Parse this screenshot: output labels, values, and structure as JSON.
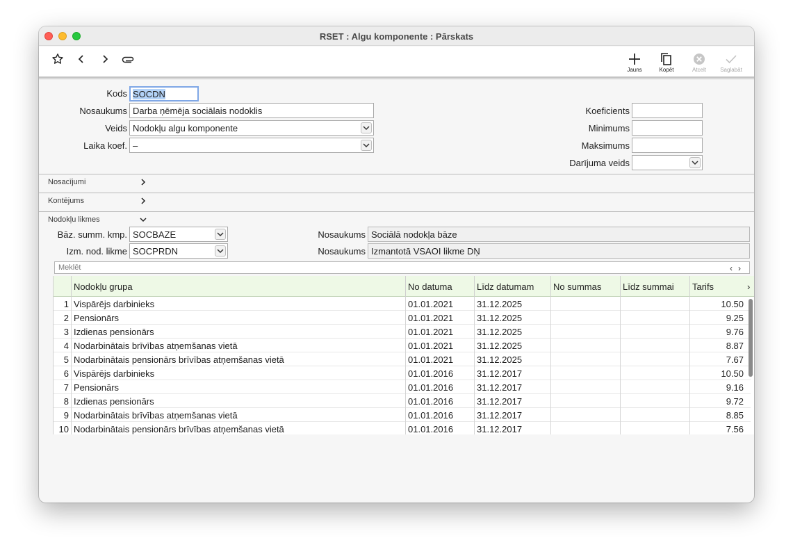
{
  "window": {
    "title": "RSET : Algu komponente : Pārskats"
  },
  "toolbar": {
    "new_label": "Jauns",
    "copy_label": "Kopēt",
    "cancel_label": "Atcelt",
    "save_label": "Saglabāt"
  },
  "form": {
    "kods_label": "Kods",
    "kods_value": "SOCDN",
    "nosaukums_label": "Nosaukums",
    "nosaukums_value": "Darba ņēmēja sociālais nodoklis",
    "veids_label": "Veids",
    "veids_value": "Nodokļu algu komponente",
    "laika_koef_label": "Laika koef.",
    "laika_koef_value": "–",
    "koeficients_label": "Koeficients",
    "koeficients_value": "",
    "minimums_label": "Minimums",
    "minimums_value": "",
    "maksimums_label": "Maksimums",
    "maksimums_value": "",
    "darijuma_veids_label": "Darījuma veids",
    "darijuma_veids_value": ""
  },
  "sections": {
    "nosacijumi": "Nosacījumi",
    "kontejums": "Kontējums",
    "nodoklu_likmes": "Nodokļu likmes"
  },
  "rates": {
    "baz_label": "Bāz. summ. kmp.",
    "baz_value": "SOCBAZE",
    "baz_name_label": "Nosaukums",
    "baz_name_value": "Sociālā nodokļa bāze",
    "izm_label": "Izm. nod. likme",
    "izm_value": "SOCPRDN",
    "izm_name_label": "Nosaukums",
    "izm_name_value": "Izmantotā VSAOI likme DŅ"
  },
  "search": {
    "placeholder": "Meklēt",
    "prev": "‹",
    "next": "›"
  },
  "grid": {
    "columns": [
      "Nodokļu grupa",
      "No datuma",
      "Līdz datumam",
      "No summas",
      "Līdz summai",
      "Tarifs"
    ],
    "more": "›",
    "rows": [
      {
        "n": "1",
        "group": "Vispārējs darbinieks",
        "from": "01.01.2021",
        "to": "31.12.2025",
        "sfrom": "",
        "sto": "",
        "tarifs": "10.50"
      },
      {
        "n": "2",
        "group": "Pensionārs",
        "from": "01.01.2021",
        "to": "31.12.2025",
        "sfrom": "",
        "sto": "",
        "tarifs": "9.25"
      },
      {
        "n": "3",
        "group": "Izdienas pensionārs",
        "from": "01.01.2021",
        "to": "31.12.2025",
        "sfrom": "",
        "sto": "",
        "tarifs": "9.76"
      },
      {
        "n": "4",
        "group": "Nodarbinātais brīvības atņemšanas vietā",
        "from": "01.01.2021",
        "to": "31.12.2025",
        "sfrom": "",
        "sto": "",
        "tarifs": "8.87"
      },
      {
        "n": "5",
        "group": "Nodarbinātais pensionārs brīvības atņemšanas vietā",
        "from": "01.01.2021",
        "to": "31.12.2025",
        "sfrom": "",
        "sto": "",
        "tarifs": "7.67"
      },
      {
        "n": "6",
        "group": "Vispārējs darbinieks",
        "from": "01.01.2016",
        "to": "31.12.2017",
        "sfrom": "",
        "sto": "",
        "tarifs": "10.50"
      },
      {
        "n": "7",
        "group": "Pensionārs",
        "from": "01.01.2016",
        "to": "31.12.2017",
        "sfrom": "",
        "sto": "",
        "tarifs": "9.16"
      },
      {
        "n": "8",
        "group": "Izdienas pensionārs",
        "from": "01.01.2016",
        "to": "31.12.2017",
        "sfrom": "",
        "sto": "",
        "tarifs": "9.72"
      },
      {
        "n": "9",
        "group": "Nodarbinātais brīvības atņemšanas vietā",
        "from": "01.01.2016",
        "to": "31.12.2017",
        "sfrom": "",
        "sto": "",
        "tarifs": "8.85"
      },
      {
        "n": "10",
        "group": "Nodarbinātais pensionārs brīvības atņemšanas vietā",
        "from": "01.01.2016",
        "to": "31.12.2017",
        "sfrom": "",
        "sto": "",
        "tarifs": "7.56"
      }
    ]
  }
}
